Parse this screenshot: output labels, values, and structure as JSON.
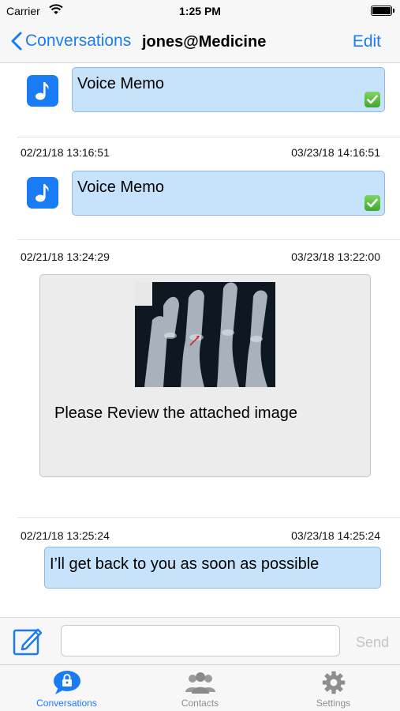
{
  "status_bar": {
    "carrier": "Carrier",
    "time": "1:25 PM"
  },
  "nav": {
    "back_label": "Conversations",
    "title": "jones@Medicine",
    "edit_label": "Edit"
  },
  "messages": [
    {
      "type": "voice",
      "label": "Voice Memo",
      "delivered": true
    },
    {
      "type": "voice",
      "sent": "02/21/18 13:16:51",
      "received": "03/23/18 14:16:51",
      "label": "Voice Memo",
      "delivered": true
    },
    {
      "type": "image",
      "sent": "02/21/18 13:24:29",
      "received": "03/23/18 13:22:00",
      "text": "Please Review the attached image"
    },
    {
      "type": "text",
      "sent": "02/21/18 13:25:24",
      "received": "03/23/18 14:25:24",
      "text": "I’ll get back to you as soon as possible"
    }
  ],
  "compose": {
    "value": "",
    "placeholder": "",
    "send_label": "Send"
  },
  "tabs": [
    {
      "label": "Conversations",
      "icon": "chat-lock-icon",
      "active": true
    },
    {
      "label": "Contacts",
      "icon": "contacts-icon",
      "active": false
    },
    {
      "label": "Settings",
      "icon": "gear-icon",
      "active": false
    }
  ],
  "colors": {
    "accent": "#1a7cf5",
    "bubble": "#c7e3fc",
    "bubble_border": "#8ab9e5",
    "card": "#ececec",
    "inactive": "#8e8e8e"
  }
}
